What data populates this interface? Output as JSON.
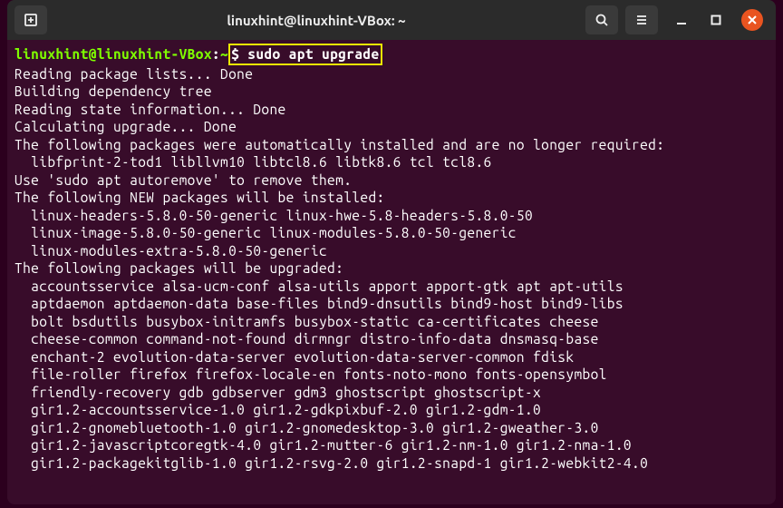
{
  "window": {
    "title": "linuxhint@linuxhint-VBox: ~"
  },
  "prompt": {
    "user": "linuxhint@linuxhint-VBox",
    "sep1": ":",
    "path": "~",
    "dollar": "$ ",
    "command": "sudo apt upgrade"
  },
  "output": [
    "Reading package lists... Done",
    "Building dependency tree",
    "Reading state information... Done",
    "Calculating upgrade... Done",
    "The following packages were automatically installed and are no longer required:",
    "  libfprint-2-tod1 libllvm10 libtcl8.6 libtk8.6 tcl tcl8.6",
    "Use 'sudo apt autoremove' to remove them.",
    "The following NEW packages will be installed:",
    "  linux-headers-5.8.0-50-generic linux-hwe-5.8-headers-5.8.0-50",
    "  linux-image-5.8.0-50-generic linux-modules-5.8.0-50-generic",
    "  linux-modules-extra-5.8.0-50-generic",
    "The following packages will be upgraded:",
    "  accountsservice alsa-ucm-conf alsa-utils apport apport-gtk apt apt-utils",
    "  aptdaemon aptdaemon-data base-files bind9-dnsutils bind9-host bind9-libs",
    "  bolt bsdutils busybox-initramfs busybox-static ca-certificates cheese",
    "  cheese-common command-not-found dirmngr distro-info-data dnsmasq-base",
    "  enchant-2 evolution-data-server evolution-data-server-common fdisk",
    "  file-roller firefox firefox-locale-en fonts-noto-mono fonts-opensymbol",
    "  friendly-recovery gdb gdbserver gdm3 ghostscript ghostscript-x",
    "  gir1.2-accountsservice-1.0 gir1.2-gdkpixbuf-2.0 gir1.2-gdm-1.0",
    "  gir1.2-gnomebluetooth-1.0 gir1.2-gnomedesktop-3.0 gir1.2-gweather-3.0",
    "  gir1.2-javascriptcoregtk-4.0 gir1.2-mutter-6 gir1.2-nm-1.0 gir1.2-nma-1.0",
    "  gir1.2-packagekitglib-1.0 gir1.2-rsvg-2.0 gir1.2-snapd-1 gir1.2-webkit2-4.0"
  ]
}
